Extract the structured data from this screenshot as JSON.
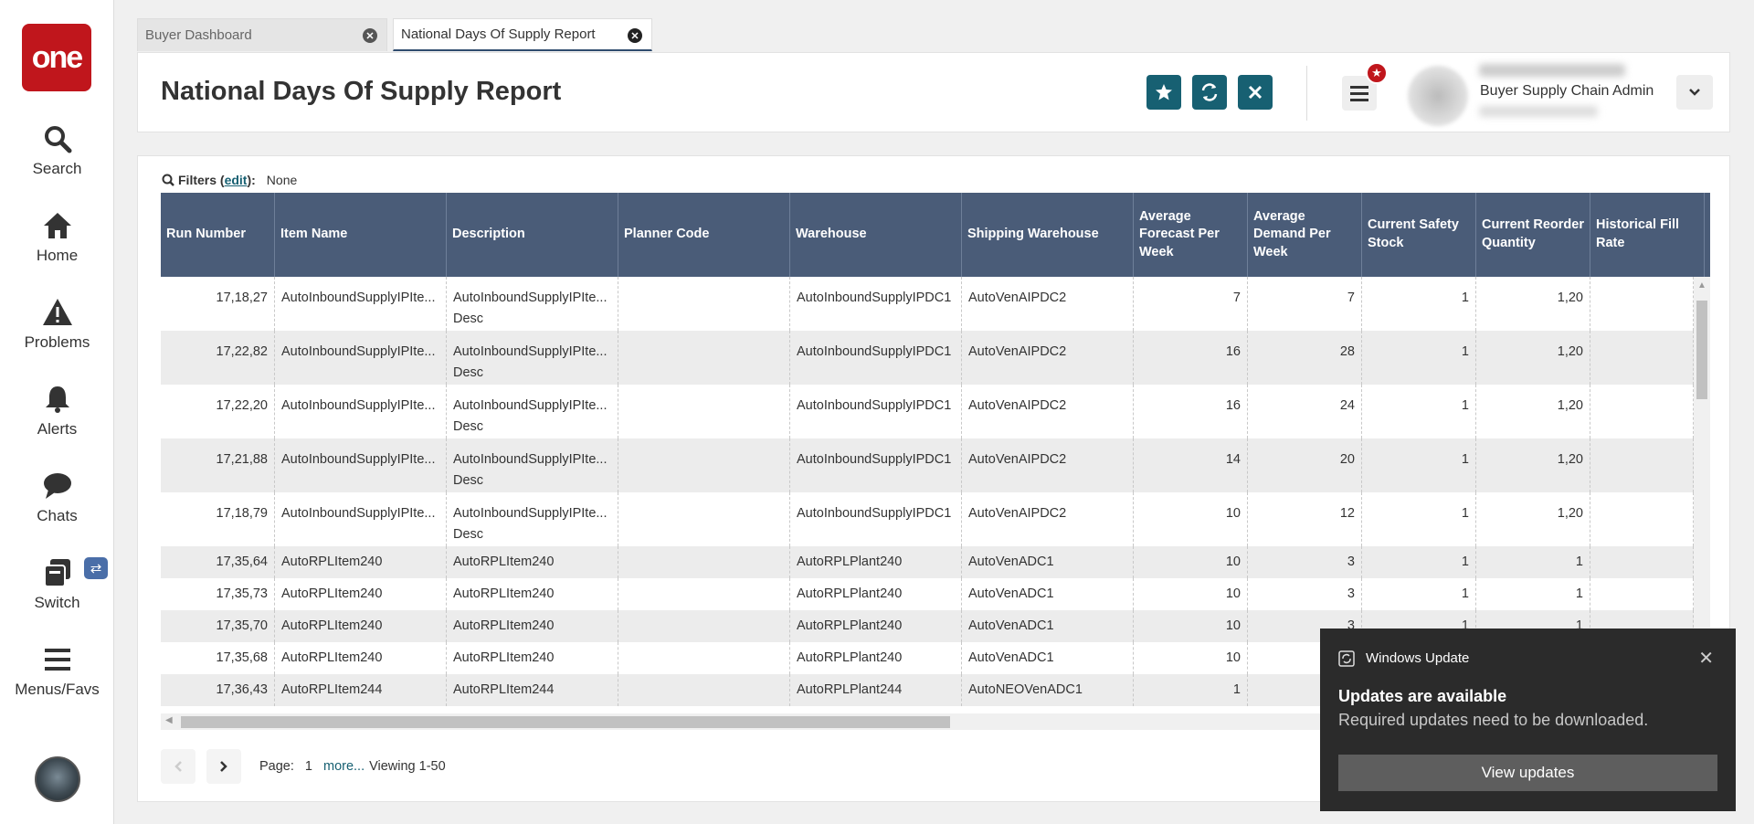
{
  "sidebar": {
    "logo": "one",
    "items": [
      {
        "label": "Search",
        "icon": "search-icon"
      },
      {
        "label": "Home",
        "icon": "home-icon"
      },
      {
        "label": "Problems",
        "icon": "warning-icon"
      },
      {
        "label": "Alerts",
        "icon": "bell-icon"
      },
      {
        "label": "Chats",
        "icon": "chat-icon"
      },
      {
        "label": "Switch",
        "icon": "switch-icon"
      },
      {
        "label": "Menus/Favs",
        "icon": "hamburger-icon"
      }
    ]
  },
  "tabs": [
    {
      "label": "Buyer Dashboard",
      "active": false
    },
    {
      "label": "National Days Of Supply Report",
      "active": true
    }
  ],
  "header": {
    "title": "National Days Of Supply Report",
    "user_role": "Buyer Supply Chain Admin"
  },
  "filters": {
    "label": "Filters",
    "edit": "edit",
    "value": "None"
  },
  "table": {
    "columns": [
      "Run Number",
      "Item Name",
      "Description",
      "Planner Code",
      "Warehouse",
      "Shipping Warehouse",
      "Average Forecast Per Week",
      "Average Demand Per Week",
      "Current Safety Stock",
      "Current Reorder Quantity",
      "Historical Fill Rate"
    ],
    "rows": [
      {
        "run": "17,18,27",
        "item": "AutoInboundSupplyIPIte...",
        "desc1": "AutoInboundSupplyIPIte...",
        "desc2": "Desc",
        "planner": "",
        "wh": "AutoInboundSupplyIPDC1",
        "ship": "AutoVenAIPDC2",
        "fc": "7",
        "dm": "7",
        "ss": "1",
        "rq": "1,20"
      },
      {
        "run": "17,22,82",
        "item": "AutoInboundSupplyIPIte...",
        "desc1": "AutoInboundSupplyIPIte...",
        "desc2": "Desc",
        "planner": "",
        "wh": "AutoInboundSupplyIPDC1",
        "ship": "AutoVenAIPDC2",
        "fc": "16",
        "dm": "28",
        "ss": "1",
        "rq": "1,20"
      },
      {
        "run": "17,22,20",
        "item": "AutoInboundSupplyIPIte...",
        "desc1": "AutoInboundSupplyIPIte...",
        "desc2": "Desc",
        "planner": "",
        "wh": "AutoInboundSupplyIPDC1",
        "ship": "AutoVenAIPDC2",
        "fc": "16",
        "dm": "24",
        "ss": "1",
        "rq": "1,20"
      },
      {
        "run": "17,21,88",
        "item": "AutoInboundSupplyIPIte...",
        "desc1": "AutoInboundSupplyIPIte...",
        "desc2": "Desc",
        "planner": "",
        "wh": "AutoInboundSupplyIPDC1",
        "ship": "AutoVenAIPDC2",
        "fc": "14",
        "dm": "20",
        "ss": "1",
        "rq": "1,20"
      },
      {
        "run": "17,18,79",
        "item": "AutoInboundSupplyIPIte...",
        "desc1": "AutoInboundSupplyIPIte...",
        "desc2": "Desc",
        "planner": "",
        "wh": "AutoInboundSupplyIPDC1",
        "ship": "AutoVenAIPDC2",
        "fc": "10",
        "dm": "12",
        "ss": "1",
        "rq": "1,20"
      },
      {
        "run": "17,35,64",
        "item": "AutoRPLItem240",
        "desc1": "AutoRPLItem240",
        "desc2": "",
        "planner": "",
        "wh": "AutoRPLPlant240",
        "ship": "AutoVenADC1",
        "fc": "10",
        "dm": "3",
        "ss": "1",
        "rq": "1"
      },
      {
        "run": "17,35,73",
        "item": "AutoRPLItem240",
        "desc1": "AutoRPLItem240",
        "desc2": "",
        "planner": "",
        "wh": "AutoRPLPlant240",
        "ship": "AutoVenADC1",
        "fc": "10",
        "dm": "3",
        "ss": "1",
        "rq": "1"
      },
      {
        "run": "17,35,70",
        "item": "AutoRPLItem240",
        "desc1": "AutoRPLItem240",
        "desc2": "",
        "planner": "",
        "wh": "AutoRPLPlant240",
        "ship": "AutoVenADC1",
        "fc": "10",
        "dm": "3",
        "ss": "1",
        "rq": "1"
      },
      {
        "run": "17,35,68",
        "item": "AutoRPLItem240",
        "desc1": "AutoRPLItem240",
        "desc2": "",
        "planner": "",
        "wh": "AutoRPLPlant240",
        "ship": "AutoVenADC1",
        "fc": "10",
        "dm": "",
        "ss": "",
        "rq": ""
      },
      {
        "run": "17,36,43",
        "item": "AutoRPLItem244",
        "desc1": "AutoRPLItem244",
        "desc2": "",
        "planner": "",
        "wh": "AutoRPLPlant244",
        "ship": "AutoNEOVenADC1",
        "fc": "1",
        "dm": "",
        "ss": "",
        "rq": ""
      }
    ]
  },
  "pager": {
    "page_label": "Page:",
    "page": "1",
    "more": "more...",
    "viewing": "Viewing 1-50"
  },
  "toast": {
    "app": "Windows Update",
    "title": "Updates are available",
    "body": "Required updates need to be downloaded.",
    "button": "View updates"
  },
  "colors": {
    "brand": "#c0161c",
    "accent": "#176072",
    "table_header": "#4a5c78"
  }
}
